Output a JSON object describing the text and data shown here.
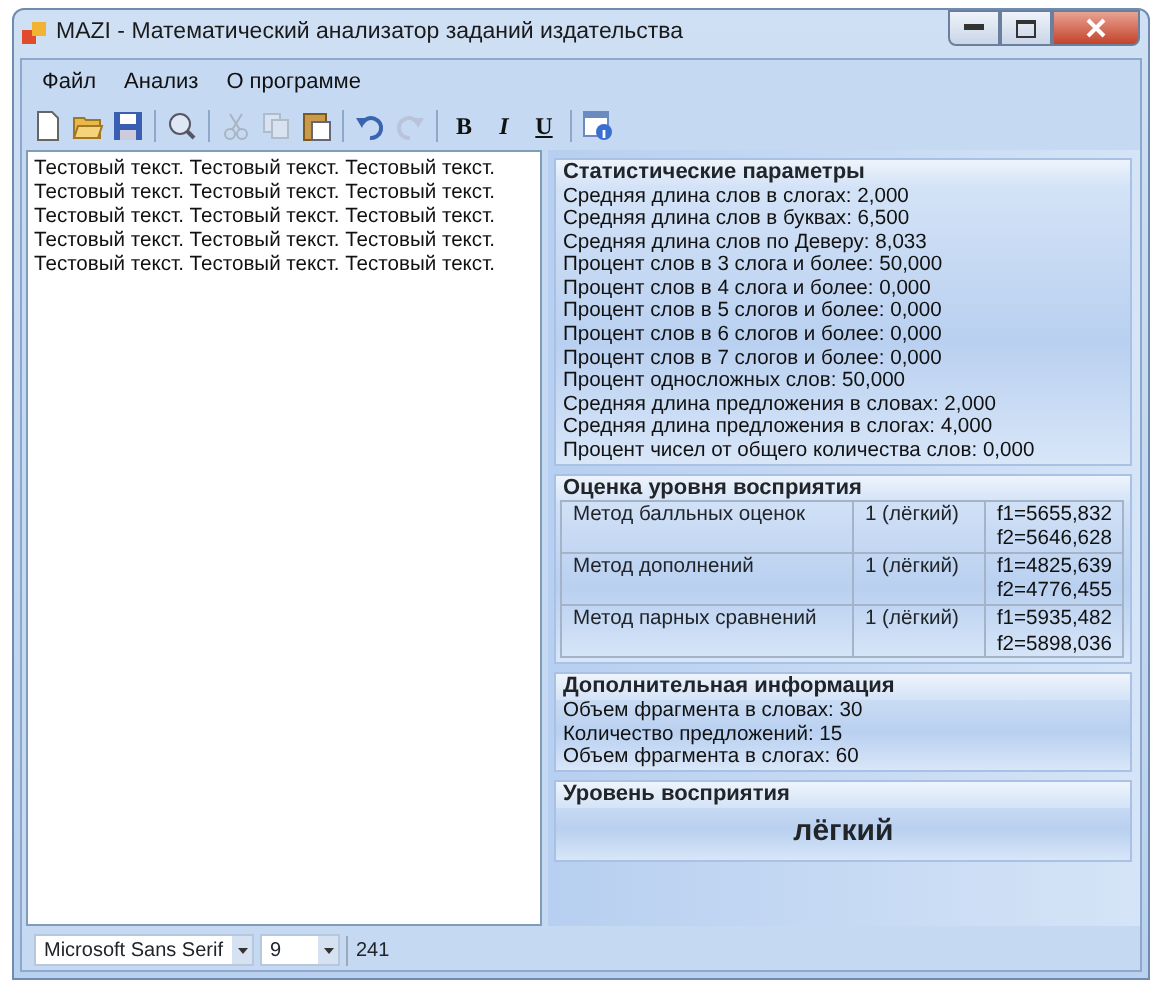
{
  "window": {
    "title": "MAZI - Математический анализатор заданий издательства"
  },
  "menu": [
    {
      "label": "Файл"
    },
    {
      "label": "Анализ"
    },
    {
      "label": "О программе"
    }
  ],
  "toolbar": [
    {
      "kind": "icon",
      "disabled": false
    },
    {
      "kind": "icon",
      "disabled": false
    },
    {
      "kind": "icon",
      "disabled": false
    },
    {
      "kind": "separator"
    },
    {
      "kind": "icon",
      "disabled": false
    },
    {
      "kind": "separator"
    },
    {
      "kind": "icon",
      "disabled": true
    },
    {
      "kind": "icon",
      "disabled": true
    },
    {
      "kind": "icon",
      "disabled": false
    },
    {
      "kind": "separator"
    },
    {
      "kind": "icon",
      "disabled": false
    },
    {
      "kind": "icon",
      "disabled": true
    },
    {
      "kind": "separator"
    },
    {
      "kind": "text",
      "label": "B"
    },
    {
      "kind": "text",
      "label": "I"
    },
    {
      "kind": "text",
      "label": "U"
    },
    {
      "kind": "separator"
    },
    {
      "kind": "icon",
      "disabled": false
    }
  ],
  "editor": {
    "lines": [
      "Тестовый текст. Тестовый текст. Тестовый текст.",
      "Тестовый текст. Тестовый текст. Тестовый текст.",
      "Тестовый текст. Тестовый текст. Тестовый текст.",
      "Тестовый текст. Тестовый текст. Тестовый текст.",
      "Тестовый текст. Тестовый текст. Тестовый текст."
    ]
  },
  "statistics": {
    "title": "Статистические параметры",
    "lines": [
      "Средняя длина слов в слогах: 2,000",
      "Средняя длина слов в буквах: 6,500",
      "Средняя длина слов по Деверу: 8,033",
      "Процент слов в 3 слога и более: 50,000",
      "Процент слов в 4 слога и более: 0,000",
      "Процент слов в 5 слогов и более: 0,000",
      "Процент слов в 6 слогов и более: 0,000",
      "Процент слов в 7 слогов и более: 0,000",
      "Процент односложных слов: 50,000",
      "Средняя длина предложения в словах: 2,000",
      "Средняя длина предложения в слогах: 4,000",
      "Процент чисел от общего количества слов: 0,000"
    ]
  },
  "assessment": {
    "title": "Оценка уровня восприятия",
    "rows": [
      {
        "method": "Метод балльных оценок",
        "level": "1 (лёгкий)",
        "f1": "f1=5655,832",
        "f2": "f2=5646,628"
      },
      {
        "method": "Метод дополнений",
        "level": "1 (лёгкий)",
        "f1": "f1=4825,639",
        "f2": "f2=4776,455"
      },
      {
        "method": "Метод парных сравнений",
        "level": "1 (лёгкий)",
        "f1": "f1=5935,482",
        "f2": "f2=5898,036"
      }
    ]
  },
  "additional": {
    "title": "Дополнительная информация",
    "lines": [
      "Объем фрагмента в словах: 30",
      "Количество предложений: 15",
      "Объем фрагмента в слогах: 60"
    ]
  },
  "perception": {
    "title": "Уровень восприятия",
    "value": "лёгкий"
  },
  "status_bar": {
    "font": "Microsoft Sans Serif",
    "size": "9",
    "count": "241"
  }
}
